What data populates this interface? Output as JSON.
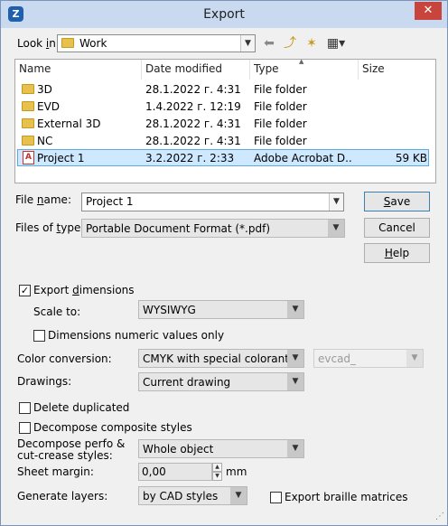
{
  "window": {
    "title": "Export",
    "app_icon": "Z",
    "close_glyph": "✕"
  },
  "lookin": {
    "label_prefix": "Look ",
    "label_accel": "i",
    "label_suffix": "n:",
    "value": "Work"
  },
  "columns": {
    "name": "Name",
    "date": "Date modified",
    "type": "Type",
    "size": "Size",
    "sort_glyph": "▲"
  },
  "files": [
    {
      "name": "3D",
      "date": "28.1.2022 г. 4:31",
      "type": "File folder",
      "size": "",
      "icon": "folder-icon"
    },
    {
      "name": "EVD",
      "date": "1.4.2022 г. 12:19",
      "type": "File folder",
      "size": "",
      "icon": "folder-icon"
    },
    {
      "name": "External 3D",
      "date": "28.1.2022 г. 4:31",
      "type": "File folder",
      "size": "",
      "icon": "folder-icon"
    },
    {
      "name": "NC",
      "date": "28.1.2022 г. 4:31",
      "type": "File folder",
      "size": "",
      "icon": "folder-icon"
    },
    {
      "name": "Project 1",
      "date": "3.2.2022 г. 2:33",
      "type": "Adobe Acrobat D...",
      "size": "59 KB",
      "icon": "pdf-icon"
    }
  ],
  "filename": {
    "label_prefix": "File ",
    "label_accel": "n",
    "label_suffix": "ame:",
    "value": "Project 1"
  },
  "filetype": {
    "label_prefix": "Files of ",
    "label_accel": "t",
    "label_suffix": "ype:",
    "value": "Portable Document Format (*.pdf)"
  },
  "buttons": {
    "save": {
      "accel": "S",
      "rest": "ave"
    },
    "cancel": "Cancel",
    "help": {
      "accel": "H",
      "rest": "elp"
    }
  },
  "options": {
    "export_dimensions": {
      "prefix": "Export ",
      "accel": "d",
      "rest": "imensions",
      "checked": true
    },
    "scale_to": {
      "label": "Scale to:",
      "value": "WYSIWYG"
    },
    "numeric_only": {
      "label": "Dimensions numeric values only",
      "checked": false
    },
    "color_conversion": {
      "label": "Color conversion:",
      "value": "CMYK with special colorants",
      "secondary_value": "evcad_"
    },
    "drawings": {
      "label": "Drawings:",
      "value": "Current drawing"
    },
    "delete_duplicated": {
      "label": "Delete duplicated",
      "checked": false
    },
    "decompose_composite": {
      "label": "Decompose composite styles",
      "checked": false
    },
    "decompose_perfo": {
      "label_line1": "Decompose perfo &",
      "label_line2": "cut-crease styles:",
      "value": "Whole object"
    },
    "sheet_margin": {
      "label": "Sheet margin:",
      "value": "0,00",
      "unit": "mm"
    },
    "generate_layers": {
      "label": "Generate layers:",
      "value": "by CAD styles"
    },
    "braille": {
      "label": "Export braille matrices",
      "checked": false
    }
  },
  "glyphs": {
    "dropdown": "▼",
    "check": "✓",
    "spin_up": "▲",
    "spin_down": "▼",
    "back": "⬅",
    "up_folder": "⤴",
    "new_folder": "✶",
    "view_menu": "▦▾",
    "grip": "⋰"
  }
}
